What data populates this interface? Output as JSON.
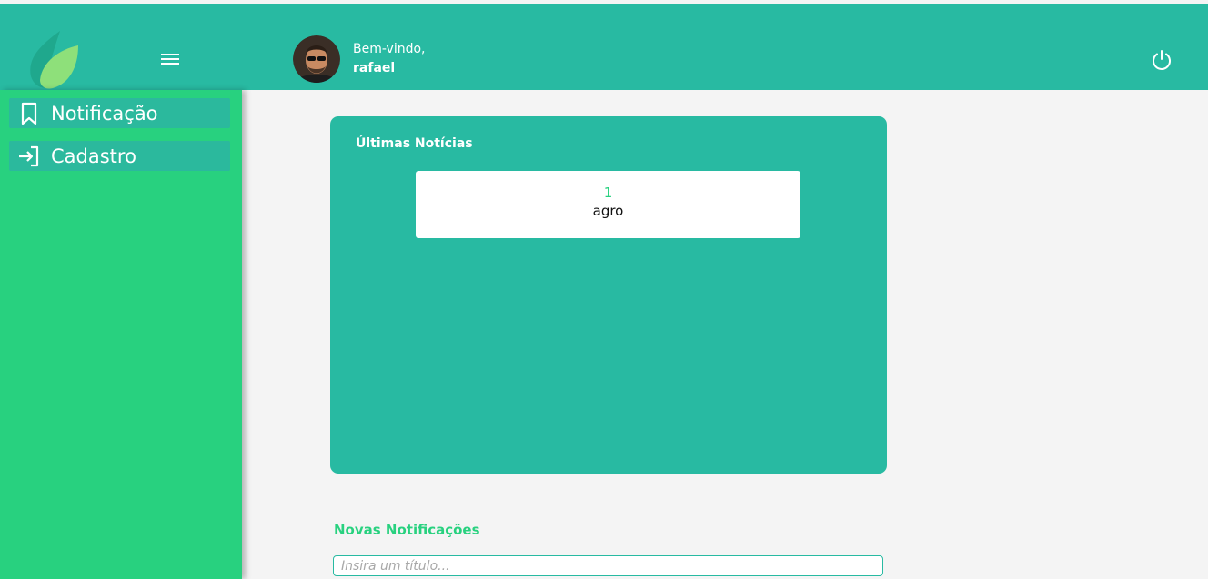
{
  "header": {
    "welcome": "Bem-vindo,",
    "user_name": "rafael"
  },
  "sidebar": {
    "items": [
      {
        "label": "Notificação",
        "icon": "bookmark-icon"
      },
      {
        "label": "Cadastro",
        "icon": "sign-in-icon"
      }
    ]
  },
  "news": {
    "title": "Últimas Notícias",
    "items": [
      {
        "number": "1",
        "text": "agro"
      }
    ]
  },
  "new_notification": {
    "title": "Novas Notificações",
    "title_placeholder": "Insira um título..."
  },
  "colors": {
    "header": "#28baa2",
    "sidebar": "#28d17f",
    "accent": "#28d17f"
  }
}
